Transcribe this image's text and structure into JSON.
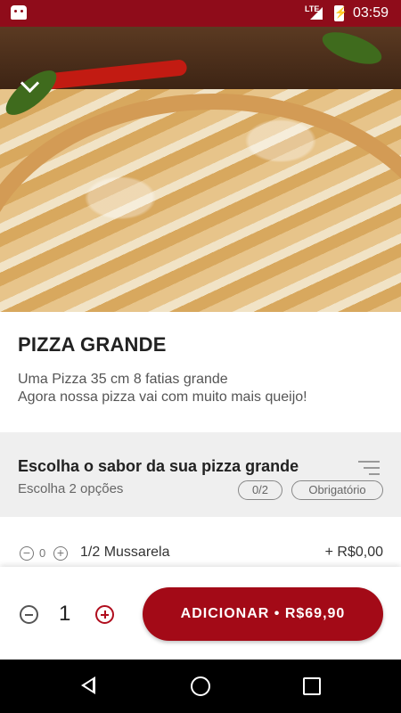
{
  "status_bar": {
    "network": "LTE",
    "time": "03:59"
  },
  "hero": {
    "image_alt": ""
  },
  "product": {
    "title": "PIZZA GRANDE",
    "description_line1": "Uma Pizza 35 cm 8 fatias grande",
    "description_line2": "Agora nossa pizza vai com muito mais queijo!"
  },
  "choice_section": {
    "title": "Escolha o sabor da sua pizza grande",
    "subtitle": "Escolha 2 opções",
    "count_badge": "0/2",
    "required_badge": "Obrigatório"
  },
  "options": [
    {
      "qty": "0",
      "label": "1/2 Mussarela",
      "price": "+ R$0,00"
    }
  ],
  "footer": {
    "quantity": "1",
    "add_button_label": "ADICIONAR • R$69,90"
  },
  "icons": {
    "back": "chevron-down-icon",
    "sort": "sort-icon",
    "minus": "minus-icon",
    "plus": "plus-icon"
  },
  "colors": {
    "brand": "#a30a17",
    "status_bar": "#8f0c1a"
  }
}
